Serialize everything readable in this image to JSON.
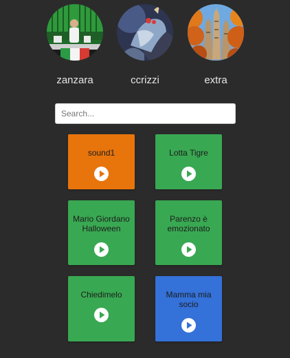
{
  "users": [
    {
      "name": "zanzara"
    },
    {
      "name": "ccrizzi"
    },
    {
      "name": "extra"
    }
  ],
  "search": {
    "placeholder": "Search...",
    "value": ""
  },
  "sounds": [
    {
      "title": "sound1",
      "color": "#e8740c"
    },
    {
      "title": "Lotta Tigre",
      "color": "#39a852"
    },
    {
      "title": "Mario Giordano Halloween",
      "color": "#39a852"
    },
    {
      "title": "Parenzo è emozionato",
      "color": "#39a852"
    },
    {
      "title": "Chiedimelo",
      "color": "#39a852"
    },
    {
      "title": "Mamma mia socio",
      "color": "#3471d8"
    }
  ],
  "colors": {
    "background": "#2b2b2b",
    "orange": "#e8740c",
    "green": "#39a852",
    "blue": "#3471d8"
  },
  "icons": {
    "play": "play-circle-icon"
  }
}
